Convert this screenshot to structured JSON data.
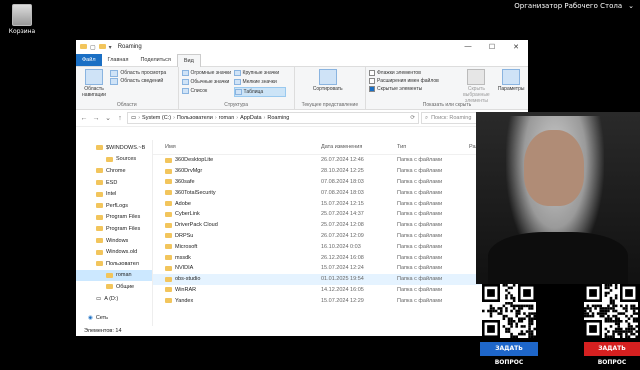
{
  "desktop": {
    "recycle_bin": "Корзина",
    "organizer": "Организатор Рабочего Стола"
  },
  "window": {
    "title": "Roaming",
    "controls": [
      "—",
      "☐",
      "✕"
    ],
    "tabs": [
      "Файл",
      "Главная",
      "Поделиться",
      "Вид"
    ],
    "ribbon": {
      "panels": {
        "nav_pane": "Область навигации",
        "preview": "Область просмотра",
        "details": "Область сведений",
        "group_label": "Области"
      },
      "layout": {
        "items": [
          "Огромные значки",
          "Крупные значки",
          "Обычные значки",
          "Мелкие значки",
          "Список",
          "Таблица"
        ],
        "group_label": "Структура"
      },
      "view": {
        "sort": "Сортировать",
        "group_label": "Текущее представление"
      },
      "show": {
        "checks": [
          "Флажки элементов",
          "Расширения имен файлов",
          "Скрытые элементы"
        ],
        "hide_selected": "Скрыть выбранные элементы",
        "params": "Параметры",
        "group_label": "Показать или скрыть"
      }
    },
    "address": {
      "parts": [
        "System (C:)",
        "Пользователи",
        "roman",
        "AppData",
        "Roaming"
      ]
    },
    "search_placeholder": "Поиск: Roaming",
    "columns": {
      "name": "Имя",
      "date": "Дата изменения",
      "type": "Тип",
      "size": "Размер"
    },
    "nav": [
      {
        "label": "$WINDOWS.~B",
        "level": 0
      },
      {
        "label": "Sources",
        "level": 1
      },
      {
        "label": "Chrome",
        "level": 0
      },
      {
        "label": "ESD",
        "level": 0
      },
      {
        "label": "Intel",
        "level": 0
      },
      {
        "label": "PerfLogs",
        "level": 0
      },
      {
        "label": "Program Files",
        "level": 0
      },
      {
        "label": "Program Files",
        "level": 0
      },
      {
        "label": "Windows",
        "level": 0
      },
      {
        "label": "Windows.old",
        "level": 0
      },
      {
        "label": "Пользовател",
        "level": 0
      },
      {
        "label": "roman",
        "level": 1,
        "selected": true
      },
      {
        "label": "Общие",
        "level": 1
      },
      {
        "label": "A (D:)",
        "level": -1
      },
      {
        "label": "Сеть",
        "level": -2
      }
    ],
    "files": [
      {
        "name": "360DesktopLite",
        "date": "26.07.2024 12:46",
        "type": "Папка с файлами"
      },
      {
        "name": "360DrvMgr",
        "date": "28.10.2024 12:25",
        "type": "Папка с файлами"
      },
      {
        "name": "360safe",
        "date": "07.08.2024 18:03",
        "type": "Папка с файлами"
      },
      {
        "name": "360TotalSecurity",
        "date": "07.08.2024 18:03",
        "type": "Папка с файлами"
      },
      {
        "name": "Adobe",
        "date": "15.07.2024 12:15",
        "type": "Папка с файлами"
      },
      {
        "name": "CyberLink",
        "date": "25.07.2024 14:37",
        "type": "Папка с файлами"
      },
      {
        "name": "DriverPack Cloud",
        "date": "25.07.2024 12:08",
        "type": "Папка с файлами"
      },
      {
        "name": "DRPSu",
        "date": "26.07.2024 12:09",
        "type": "Папка с файлами"
      },
      {
        "name": "Microsoft",
        "date": "16.10.2024 0:03",
        "type": "Папка с файлами"
      },
      {
        "name": "mssdk",
        "date": "26.12.2024 16:08",
        "type": "Папка с файлами"
      },
      {
        "name": "NVIDIA",
        "date": "15.07.2024 12:24",
        "type": "Папка с файлами"
      },
      {
        "name": "obs-studio",
        "date": "01.01.2025 19:54",
        "type": "Папка с файлами",
        "selected": true
      },
      {
        "name": "WinRAR",
        "date": "14.12.2024 16:05",
        "type": "Папка с файлами"
      },
      {
        "name": "Yandex",
        "date": "15.07.2024 12:29",
        "type": "Папка с файлами"
      }
    ],
    "status": "Элементов: 14"
  },
  "overlay": {
    "ask_left": "ЗАДАТЬ ВОПРОС",
    "ask_right": "ЗАДАТЬ ВОПРОС"
  },
  "colors": {
    "accent": "#1a6fc4",
    "folder": "#f2c55c",
    "selection": "#cce8ff",
    "ask_left": "#1e66c9",
    "ask_right": "#d52020"
  }
}
